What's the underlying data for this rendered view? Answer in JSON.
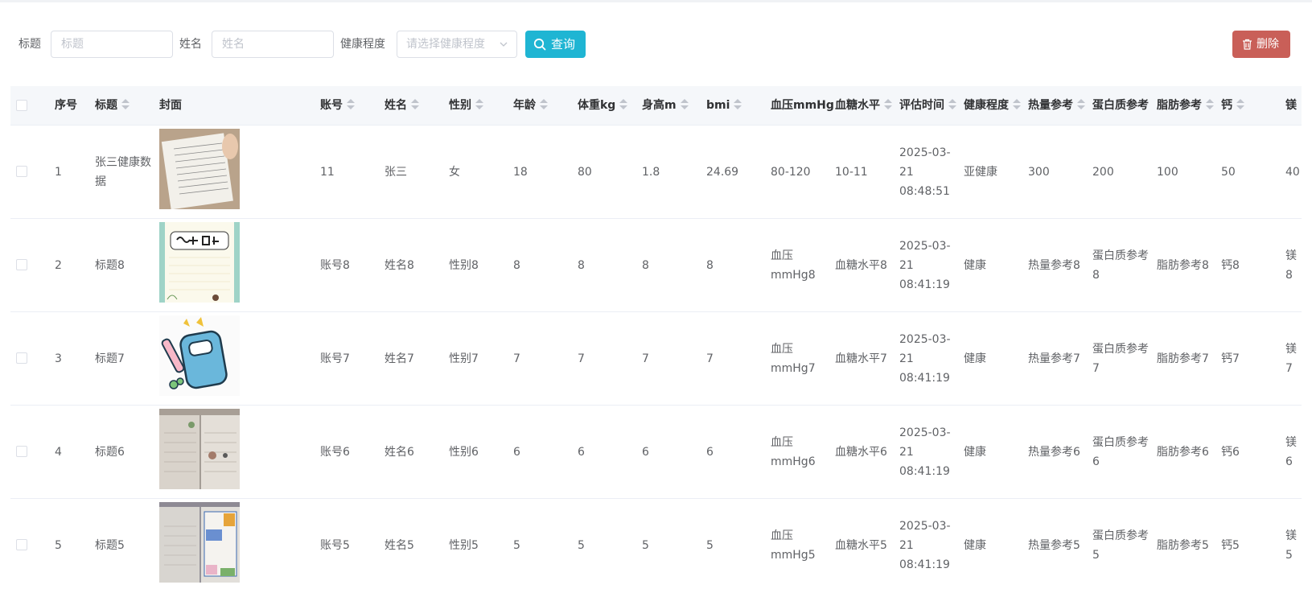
{
  "filters": {
    "title_label": "标题",
    "title_placeholder": "标题",
    "name_label": "姓名",
    "name_placeholder": "姓名",
    "health_label": "健康程度",
    "health_placeholder": "请选择健康程度",
    "query_label": "查询",
    "delete_label": "删除"
  },
  "columns": [
    "序号",
    "标题",
    "封面",
    "账号",
    "姓名",
    "性别",
    "年龄",
    "体重kg",
    "身高m",
    "bmi",
    "血压mmHg",
    "血糖水平",
    "评估时间",
    "健康程度",
    "热量参考",
    "蛋白质参考",
    "脂肪参考",
    "钙",
    "镁"
  ],
  "rows": [
    {
      "idx": "1",
      "title": "张三健康数据",
      "account": "11",
      "name": "张三",
      "gender": "女",
      "age": "18",
      "weight": "80",
      "height": "1.8",
      "bmi": "24.69",
      "bp": "80-120",
      "sugar": "10-11",
      "time": "2025-03-21 08:48:51",
      "health": "亚健康",
      "calorie": "300",
      "protein": "200",
      "fat": "100",
      "calcium": "50",
      "magnesium": "40"
    },
    {
      "idx": "2",
      "title": "标题8",
      "account": "账号8",
      "name": "姓名8",
      "gender": "性别8",
      "age": "8",
      "weight": "8",
      "height": "8",
      "bmi": "8",
      "bp": "血压mmHg8",
      "sugar": "血糖水平8",
      "time": "2025-03-21 08:41:19",
      "health": "健康",
      "calorie": "热量参考8",
      "protein": "蛋白质参考8",
      "fat": "脂肪参考8",
      "calcium": "钙8",
      "magnesium": "镁8"
    },
    {
      "idx": "3",
      "title": "标题7",
      "account": "账号7",
      "name": "姓名7",
      "gender": "性别7",
      "age": "7",
      "weight": "7",
      "height": "7",
      "bmi": "7",
      "bp": "血压mmHg7",
      "sugar": "血糖水平7",
      "time": "2025-03-21 08:41:19",
      "health": "健康",
      "calorie": "热量参考7",
      "protein": "蛋白质参考7",
      "fat": "脂肪参考7",
      "calcium": "钙7",
      "magnesium": "镁7"
    },
    {
      "idx": "4",
      "title": "标题6",
      "account": "账号6",
      "name": "姓名6",
      "gender": "性别6",
      "age": "6",
      "weight": "6",
      "height": "6",
      "bmi": "6",
      "bp": "血压mmHg6",
      "sugar": "血糖水平6",
      "time": "2025-03-21 08:41:19",
      "health": "健康",
      "calorie": "热量参考6",
      "protein": "蛋白质参考6",
      "fat": "脂肪参考6",
      "calcium": "钙6",
      "magnesium": "镁6"
    },
    {
      "idx": "5",
      "title": "标题5",
      "account": "账号5",
      "name": "姓名5",
      "gender": "性别5",
      "age": "5",
      "weight": "5",
      "height": "5",
      "bmi": "5",
      "bp": "血压mmHg5",
      "sugar": "血糖水平5",
      "time": "2025-03-21 08:41:19",
      "health": "健康",
      "calorie": "热量参考5",
      "protein": "蛋白质参考5",
      "fat": "脂肪参考5",
      "calcium": "钙5",
      "magnesium": "镁5"
    }
  ],
  "colors": {
    "primary": "#1fb5d3",
    "danger": "#c95f58",
    "header_bg": "#f5f7fa",
    "border": "#ebeef5",
    "text": "#606266"
  },
  "icons": {
    "query": "search-icon",
    "delete": "trash-icon",
    "select": "chevron-down-icon"
  }
}
